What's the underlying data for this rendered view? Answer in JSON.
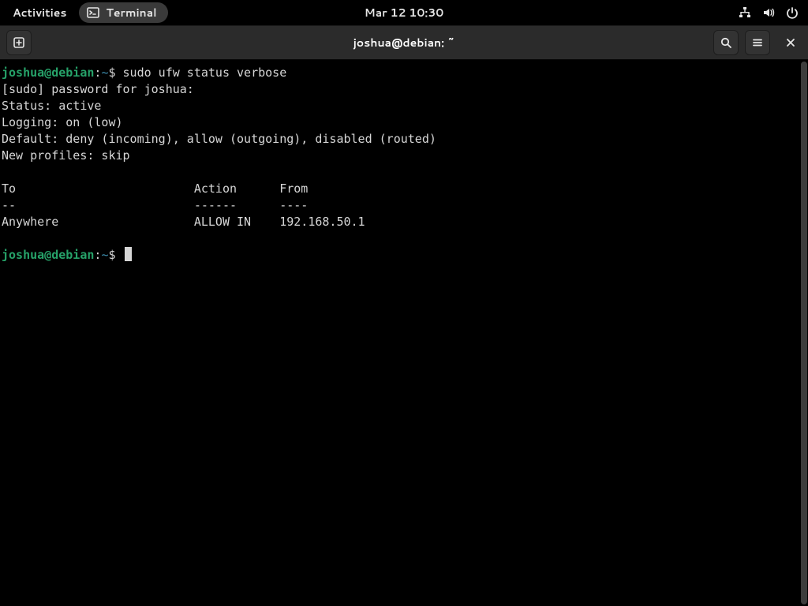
{
  "topbar": {
    "activities": "Activities",
    "app_name": "Terminal",
    "datetime": "Mar 12  10:30"
  },
  "window": {
    "title": "joshua@debian: ~"
  },
  "colors": {
    "prompt_user": "#26a269",
    "prompt_path": "#3e8fb0",
    "term_fg": "#d6d6d6"
  },
  "prompt": {
    "user_host": "joshua@debian",
    "sep": ":",
    "path": "~",
    "symbol": "$"
  },
  "session": {
    "cmd1": "sudo ufw status verbose",
    "line_sudo": "[sudo] password for joshua:",
    "line_status": "Status: active",
    "line_logging": "Logging: on (low)",
    "line_default": "Default: deny (incoming), allow (outgoing), disabled (routed)",
    "line_profiles": "New profiles: skip",
    "hdr_row": "To                         Action      From",
    "hdr_sep": "--                         ------      ----",
    "rule_row": "Anywhere                   ALLOW IN    192.168.50.1"
  }
}
